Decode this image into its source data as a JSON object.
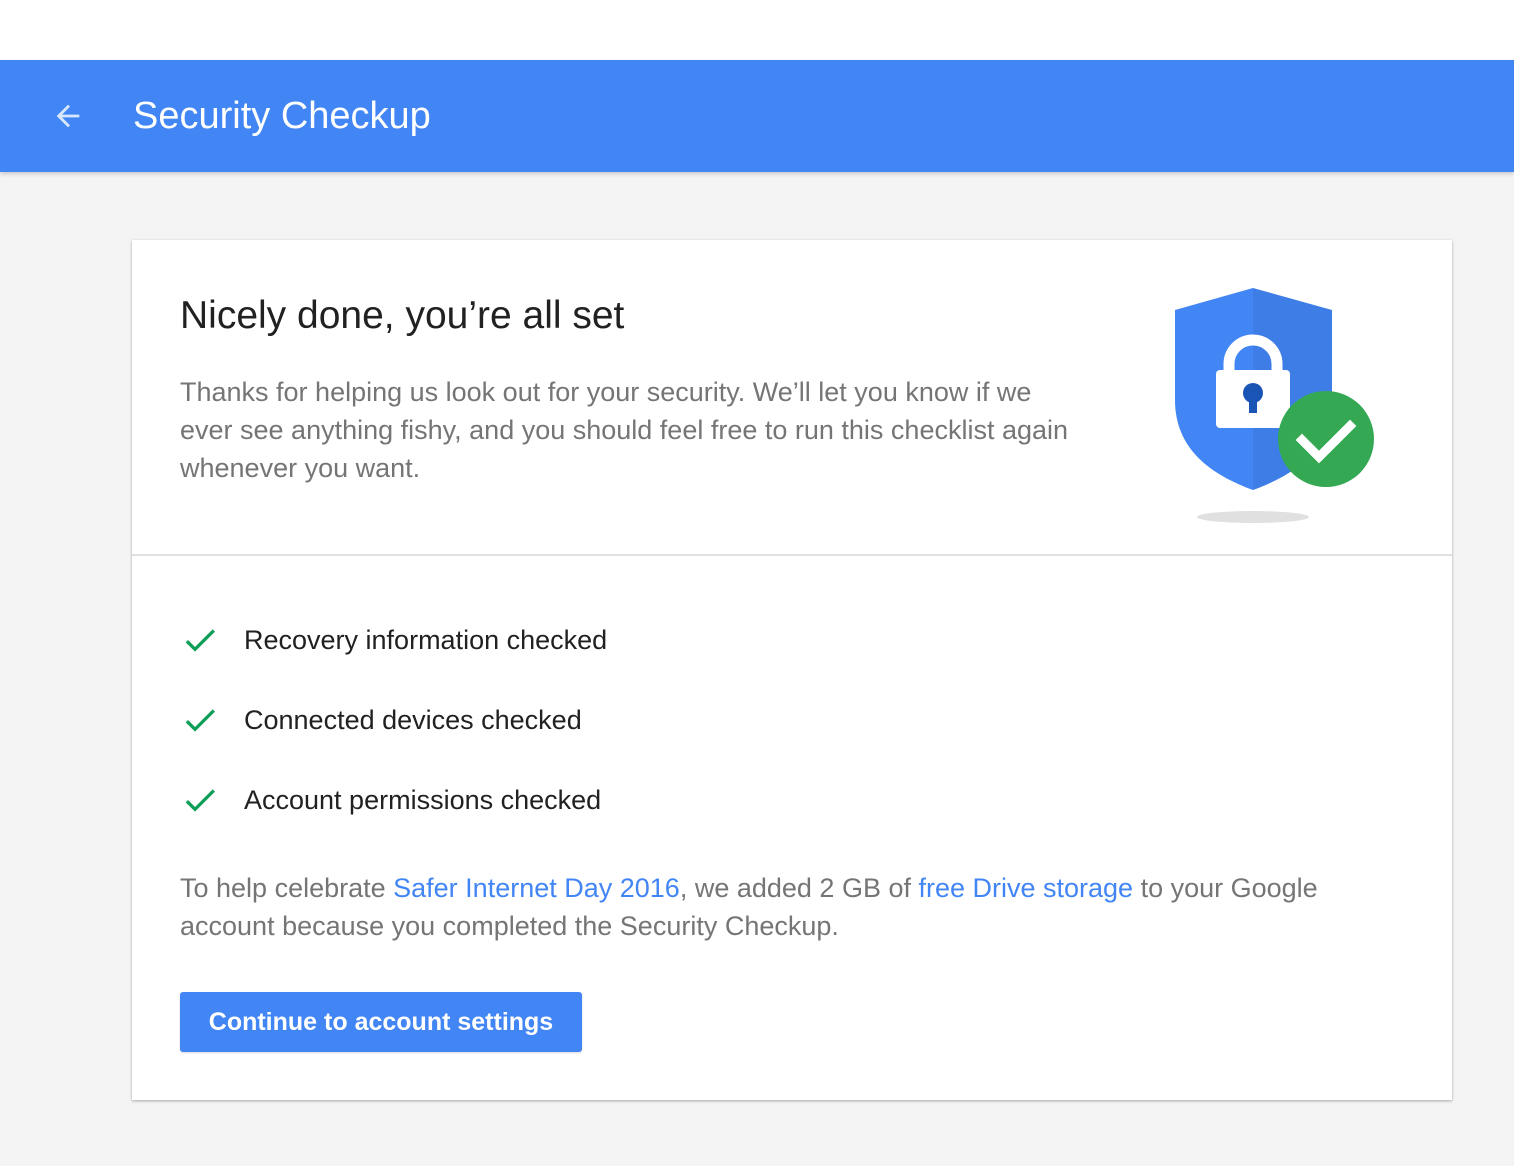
{
  "header": {
    "back_icon": "arrow-back-icon",
    "title": "Security Checkup"
  },
  "card": {
    "headline": "Nicely done, you’re all set",
    "intro": "Thanks for helping us look out for your security. We’ll let you know if we ever see anything fishy, and you should feel free to run this checklist again whenever you want.",
    "illustration": {
      "shield_icon": "shield-lock-icon",
      "badge_icon": "check-circle-icon"
    },
    "checklist": [
      {
        "icon": "check-icon",
        "label": "Recovery information checked"
      },
      {
        "icon": "check-icon",
        "label": "Connected devices checked"
      },
      {
        "icon": "check-icon",
        "label": "Account permissions checked"
      }
    ],
    "promo": {
      "text_1": "To help celebrate ",
      "link_1": "Safer Internet Day 2016",
      "text_2": ", we added 2 GB of ",
      "link_2": "free Drive storage",
      "text_3": " to your Google account because you completed the Security Checkup."
    },
    "continue_label": "Continue to account settings"
  },
  "colors": {
    "primary_blue": "#4285f4",
    "success_green": "#34a853",
    "check_green": "#0f9d58",
    "headline_text": "#212121",
    "secondary_text": "#757575",
    "page_background": "#f4f4f4"
  }
}
